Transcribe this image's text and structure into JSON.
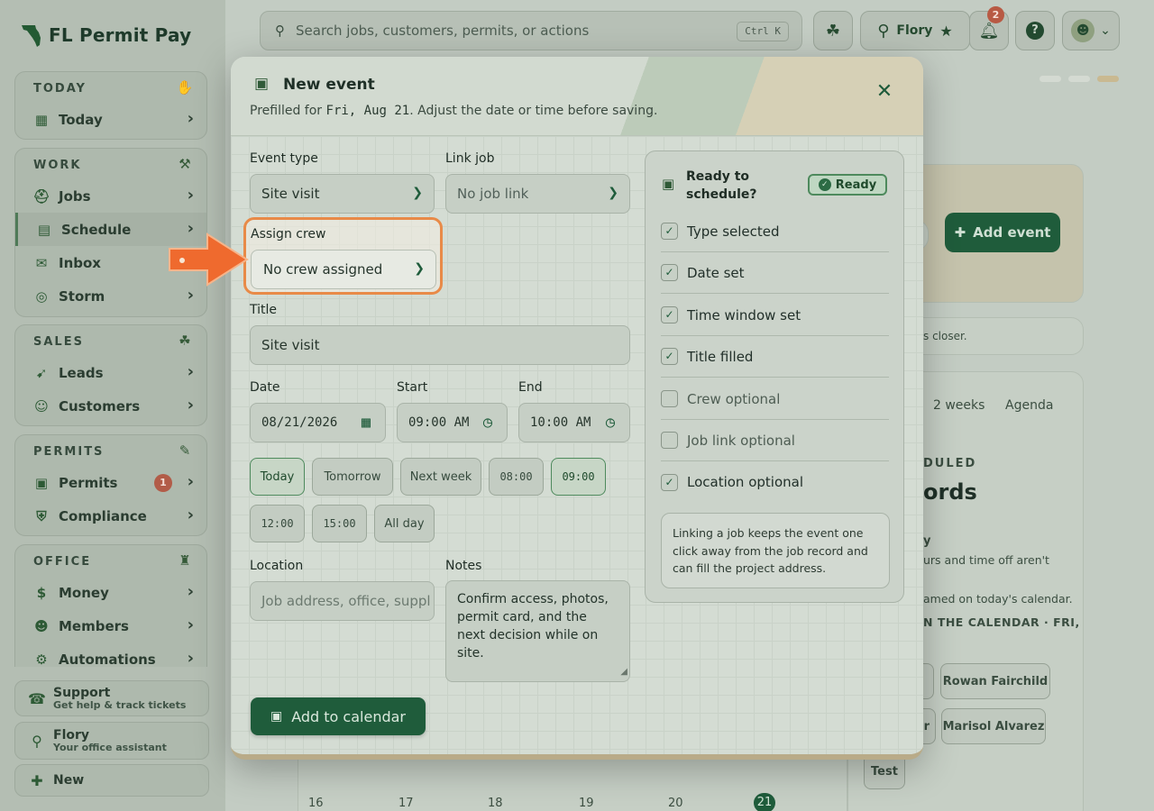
{
  "app": {
    "name": "FL Permit Pay"
  },
  "sidebar": {
    "sections": [
      {
        "title": "TODAY",
        "icon": "hand-icon",
        "items": [
          {
            "label": "Today",
            "icon": "calendar-icon"
          }
        ]
      },
      {
        "title": "WORK",
        "icon": "worker-icon",
        "items": [
          {
            "label": "Jobs",
            "icon": "hardhat-icon"
          },
          {
            "label": "Schedule",
            "icon": "schedule-icon",
            "active": true
          },
          {
            "label": "Inbox",
            "icon": "inbox-icon"
          },
          {
            "label": "Storm",
            "icon": "storm-icon"
          }
        ]
      },
      {
        "title": "SALES",
        "icon": "sales-icon",
        "items": [
          {
            "label": "Leads",
            "icon": "leads-icon"
          },
          {
            "label": "Customers",
            "icon": "customers-icon"
          }
        ]
      },
      {
        "title": "PERMITS",
        "icon": "pen-icon",
        "items": [
          {
            "label": "Permits",
            "icon": "permit-icon",
            "badge": "1"
          },
          {
            "label": "Compliance",
            "icon": "shield-icon"
          }
        ]
      },
      {
        "title": "OFFICE",
        "icon": "office-icon",
        "items": [
          {
            "label": "Money",
            "icon": "money-icon"
          },
          {
            "label": "Members",
            "icon": "members-icon"
          },
          {
            "label": "Automations",
            "icon": "automation-icon"
          }
        ]
      }
    ],
    "bottom": [
      {
        "title": "Support",
        "subtitle": "Get help & track tickets",
        "icon": "support-icon"
      },
      {
        "title": "Flory",
        "subtitle": "Your office assistant",
        "icon": "flamingo-icon"
      },
      {
        "title": "New",
        "subtitle": "",
        "icon": "new-icon"
      }
    ]
  },
  "topbar": {
    "search_placeholder": "Search jobs, customers, permits, or actions",
    "shortcut": "Ctrl K",
    "assistant_name": "Flory",
    "notification_count": "2"
  },
  "background": {
    "add_event": "Add event",
    "hint": "s closer.",
    "views": [
      "2 weeks",
      "Agenda"
    ],
    "scheduled_label": "DULED",
    "scheduled_heading": "ords",
    "para1": "y",
    "para2": "urs and time off aren't",
    "para3": "amed on today's calendar.",
    "para4": "N THE CALENDAR · FRI,",
    "chips": [
      "Rowan Fairchild",
      "Marisol Alvarez",
      "Test",
      "r"
    ],
    "calendar_days": [
      "16",
      "17",
      "18",
      "19",
      "20",
      "21"
    ]
  },
  "modal": {
    "title": "New event",
    "subtitle_prefix": "Prefilled for",
    "subtitle_date": "Fri, Aug 21",
    "subtitle_suffix": ". Adjust the date or time before saving.",
    "event_type_label": "Event type",
    "event_type_value": "Site visit",
    "link_job_label": "Link job",
    "link_job_value": "No job link",
    "assign_crew_label": "Assign crew",
    "assign_crew_value": "No crew assigned",
    "title_label": "Title",
    "title_value": "Site visit",
    "date_label": "Date",
    "date_value": "08/21/2026",
    "start_label": "Start",
    "start_value": "09:00 AM",
    "end_label": "End",
    "end_value": "10:00 AM",
    "quick_buttons": [
      "Today",
      "Tomorrow",
      "Next week",
      "08:00",
      "09:00",
      "12:00",
      "15:00",
      "All day"
    ],
    "location_label": "Location",
    "location_placeholder": "Job address, office, suppl",
    "notes_label": "Notes",
    "notes_value": "Confirm access, photos, permit card, and the next decision while on site.",
    "submit_label": "Add to calendar",
    "checklist": {
      "title": "Ready to schedule?",
      "badge": "Ready",
      "items": [
        {
          "label": "Type selected",
          "checked": true
        },
        {
          "label": "Date set",
          "checked": true
        },
        {
          "label": "Time window set",
          "checked": true
        },
        {
          "label": "Title filled",
          "checked": true
        },
        {
          "label": "Crew optional",
          "checked": false
        },
        {
          "label": "Job link optional",
          "checked": false
        },
        {
          "label": "Location optional",
          "checked": true
        }
      ],
      "tip": "Linking a job keeps the event one click away from the job record and can fill the project address."
    }
  },
  "colors": {
    "accent": "#1f5c3b",
    "highlight": "#e88a48",
    "arrow": "#ef6a2e"
  }
}
